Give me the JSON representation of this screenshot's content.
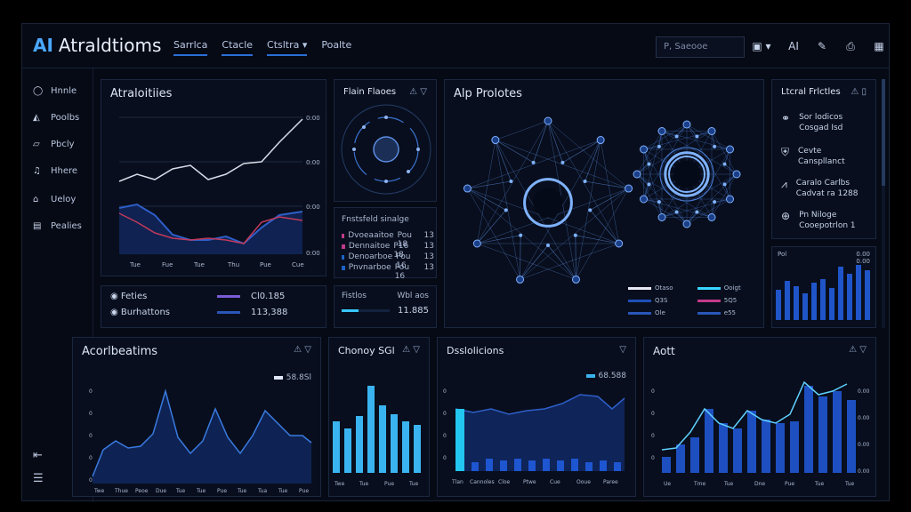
{
  "app": {
    "logo_mark": "AI",
    "title": "Atraldtioms"
  },
  "nav": [
    {
      "label": "Sarrlca",
      "active": true
    },
    {
      "label": "Ctacle",
      "active": true
    },
    {
      "label": "Ctsltra ▾",
      "active": true
    },
    {
      "label": "Poalte",
      "active": false
    }
  ],
  "search": {
    "placeholder": "P, Saeooe"
  },
  "header_icons": [
    "dropdown-icon",
    "ai-icon",
    "pen-icon",
    "file-icon",
    "grid-icon"
  ],
  "header_icon_glyphs": [
    "▣ ▾",
    "AI",
    "✎",
    "⎙",
    "▦"
  ],
  "sidebar": {
    "items": [
      {
        "icon": "home-icon",
        "glyph": "◯",
        "label": "Hnnle"
      },
      {
        "icon": "layers-icon",
        "glyph": "◭",
        "label": "Poolbs"
      },
      {
        "icon": "folder-icon",
        "glyph": "▱",
        "label": "Pbcly"
      },
      {
        "icon": "music-icon",
        "glyph": "♫",
        "label": "Hhere"
      },
      {
        "icon": "lock-icon",
        "glyph": "⌂",
        "label": "Ueloy"
      },
      {
        "icon": "document-icon",
        "glyph": "▤",
        "label": "Pealies"
      }
    ],
    "bottom_glyphs": [
      "⇤",
      "☰"
    ]
  },
  "analytics_panel": {
    "title": "Atraloitiies",
    "y_ticks": [
      "0:00",
      "0:00",
      "0:00",
      "0:00"
    ],
    "x_ticks": [
      "Tue",
      "Fue",
      "Tue",
      "Thu",
      "Pue",
      "Cue"
    ]
  },
  "legend_panel": {
    "rows": [
      {
        "label": "Feties",
        "value": "Cl0.185",
        "color": "#7a5cd6"
      },
      {
        "label": "Burhattons",
        "value": "113,388",
        "color": "#2a56b8"
      }
    ]
  },
  "flow_panel": {
    "title": "Flain Flaoes",
    "list_title": "Fnstsfeld sinalge",
    "list": [
      {
        "label": "Dvoeaaitoe",
        "v1": "Pou 18",
        "v2": "13",
        "color": "#c23a8a"
      },
      {
        "label": "Dennaitoe",
        "v1": "P16 18",
        "v2": "13",
        "color": "#c23a8a"
      },
      {
        "label": "Denoarboe",
        "v1": "Pou 16",
        "v2": "13",
        "color": "#1e62c8"
      },
      {
        "label": "Pnvnarboe",
        "v1": "Pou 16",
        "v2": "13",
        "color": "#1e62c8"
      }
    ],
    "progress_label": "Fistlos",
    "progress_unit": "Wbl aos",
    "progress_value": "11.885",
    "progress_fraction": 0.35
  },
  "network_panel": {
    "title": "Alp Prolotes",
    "legend": [
      {
        "label": "Otaso",
        "color": "#e6e8f6"
      },
      {
        "label": "Ooigt",
        "color": "#38d6ff"
      },
      {
        "label": "Q3S",
        "color": "#1e4eb8"
      },
      {
        "label": "5Q5",
        "color": "#c23a8a"
      },
      {
        "label": "Ole",
        "color": "#2a56b8"
      },
      {
        "label": "e55",
        "color": "#2a56b8"
      }
    ]
  },
  "local_panel": {
    "title": "Ltcral Frlctles",
    "items": [
      {
        "icon": "link-icon",
        "glyph": "⚭",
        "title": "Sor lodicos",
        "sub": "Cosgad Isd"
      },
      {
        "icon": "shield-icon",
        "glyph": "⛨",
        "title": "Cevte",
        "sub": "Canspllanct"
      },
      {
        "icon": "mountain-icon",
        "glyph": "⩘",
        "title": "Caralo Carlbs",
        "sub": "Cadvat ra 1288"
      },
      {
        "icon": "globe-icon",
        "glyph": "⊕",
        "title": "Pn Niloge",
        "sub": "Cooepotrlon 1"
      }
    ],
    "chart_labels": [
      "Pol",
      "0.00",
      "0.00"
    ]
  },
  "bottom1": {
    "title": "Acorlbeatims",
    "legend": "58.8Sl",
    "x_ticks": [
      "Twe",
      "Thue",
      "Peoe",
      "Due",
      "Tue",
      "Tue",
      "Pue",
      "Tue",
      "Tua",
      "Tue",
      "Pue"
    ]
  },
  "bottom2": {
    "title": "Chonoy SGl",
    "x_ticks": [
      "Twe",
      "Tue",
      "Pue",
      "Tue"
    ]
  },
  "bottom3": {
    "title": "Dsslolicions",
    "legend": "68.588",
    "x_ticks": [
      "Tlan",
      "Cannoles",
      "Cloe",
      "Ptwe",
      "Cue",
      "Ooue",
      "Paree"
    ]
  },
  "bottom4": {
    "title": "Aott",
    "x_ticks": [
      "Ue",
      "Tme",
      "Tue",
      "Dne",
      "Pue",
      "Tue",
      "Tue"
    ]
  },
  "colors": {
    "background": "#060a15",
    "panel": "#080e1d",
    "accent": "#2a6fd6",
    "cyan": "#38c8ff",
    "magenta": "#c23a5a"
  }
}
